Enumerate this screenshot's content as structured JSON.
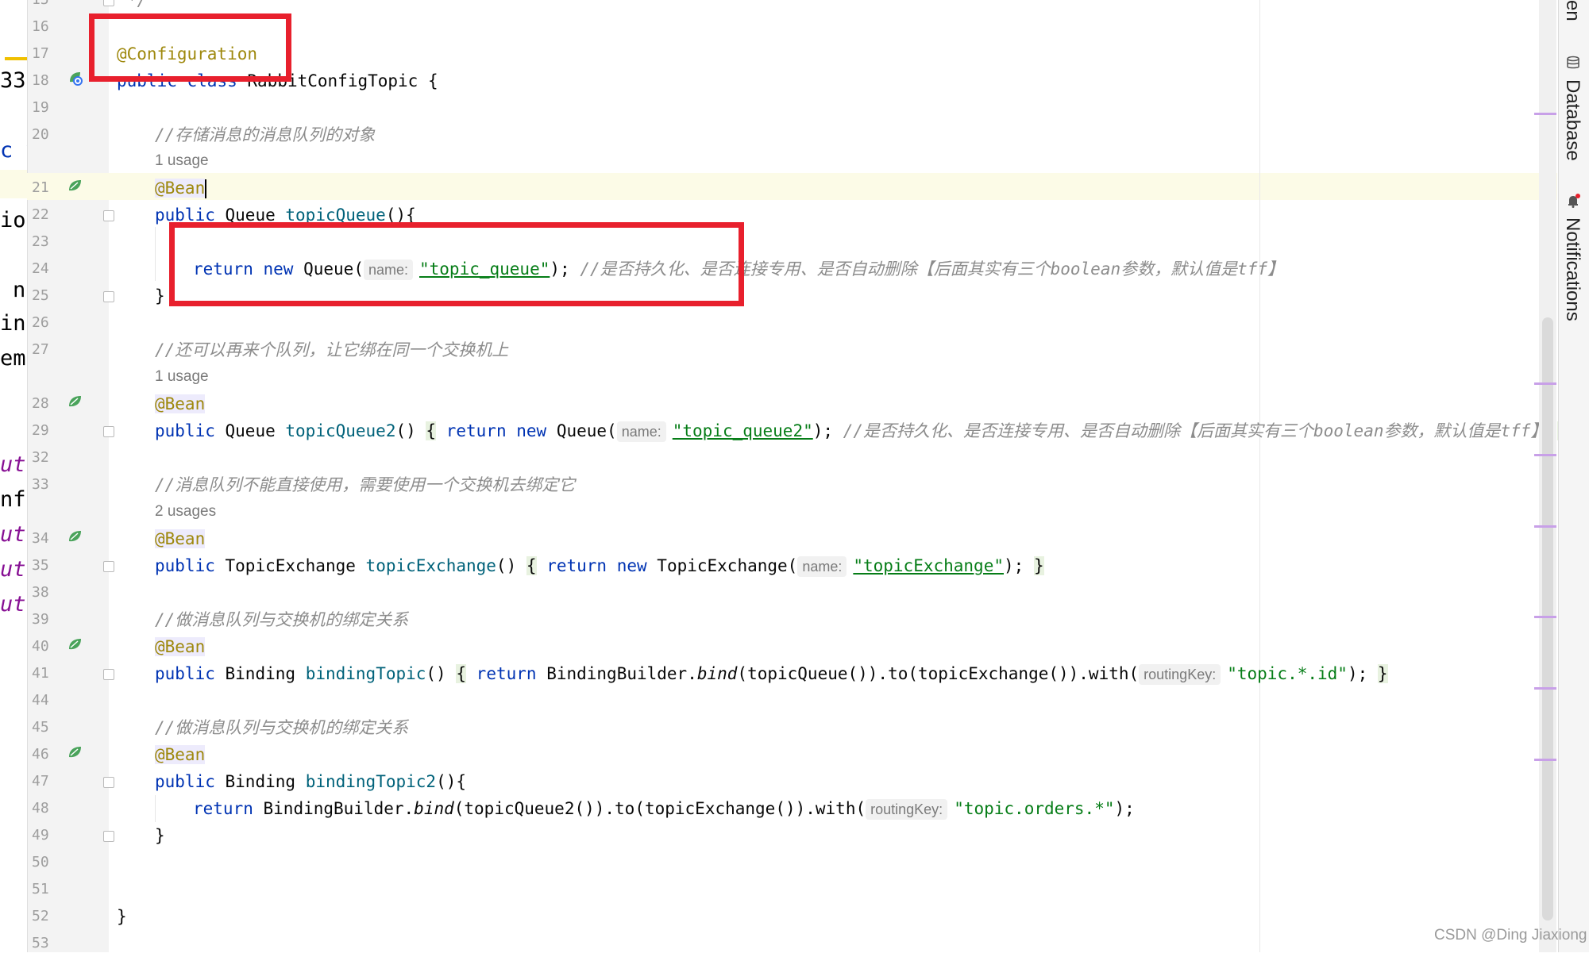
{
  "left_panel": {
    "fragments": [
      "33",
      "c v",
      "ion",
      "na",
      "ing",
      "em",
      "ut",
      "nfi",
      "ut",
      "ut",
      "ut"
    ]
  },
  "line_numbers": [
    "15",
    "16",
    "17",
    "18",
    "19",
    "20",
    "21",
    "22",
    "23",
    "24",
    "25",
    "26",
    "27",
    "28",
    "29",
    "32",
    "33",
    "34",
    "35",
    "38",
    "39",
    "40",
    "41",
    "44",
    "45",
    "46",
    "47",
    "48",
    "49",
    "50",
    "51",
    "52",
    "53"
  ],
  "code": {
    "l15": "*/",
    "l17": "@Configuration",
    "l18_kw1": "public",
    "l18_kw2": "class",
    "l18_name": "RabbitConfigTopic {",
    "l20_comment": "//存储消息的消息队列的对象",
    "usage1": "1 usage",
    "l21_ann": "@Bean",
    "l22_kw": "public",
    "l22_type": "Queue",
    "l22_fn": "topicQueue",
    "l22_rest": "(){",
    "l24_kw1": "return",
    "l24_kw2": "new",
    "l24_type": "Queue(",
    "l24_hint": "name:",
    "l24_str": "\"topic_queue\"",
    "l24_end": ");",
    "l24_comment": "//是否持久化、是否连接专用、是否自动删除【后面其实有三个boolean参数，默认值是tff】",
    "l25": "}",
    "l27_comment": "//还可以再来个队列，让它绑在同一个交换机上",
    "usage2": "1 usage",
    "l28_ann": "@Bean",
    "l29_kw": "public",
    "l29_type": "Queue",
    "l29_fn": "topicQueue2",
    "l29_parens": "()",
    "l29_open": "{",
    "l29_kw2": "return",
    "l29_kw3": "new",
    "l29_type2": "Queue(",
    "l29_hint": "name:",
    "l29_str": "\"topic_queue2\"",
    "l29_end": ");",
    "l29_comment": "//是否持久化、是否连接专用、是否自动删除【后面其实有三个boolean参数，默认值是tff】",
    "l29_close": "}",
    "l33_comment": "//消息队列不能直接使用，需要使用一个交换机去绑定它",
    "usage3": "2 usages",
    "l34_ann": "@Bean",
    "l35_kw": "public",
    "l35_type": "TopicExchange",
    "l35_fn": "topicExchange",
    "l35_parens": "()",
    "l35_open": "{",
    "l35_kw2": "return",
    "l35_kw3": "new",
    "l35_type2": "TopicExchange(",
    "l35_hint": "name:",
    "l35_str": "\"topicExchange\"",
    "l35_end": ");",
    "l35_close": "}",
    "l39_comment": "//做消息队列与交换机的绑定关系",
    "l40_ann": "@Bean",
    "l41_kw": "public",
    "l41_type": "Binding",
    "l41_fn": "bindingTopic",
    "l41_parens": "()",
    "l41_open": "{",
    "l41_kw2": "return",
    "l41_cls": "BindingBuilder.",
    "l41_bind": "bind",
    "l41_rest": "(topicQueue()).to(topicExchange()).with(",
    "l41_hint": "routingKey:",
    "l41_str": "\"topic.*.id\"",
    "l41_end": ");",
    "l41_close": "}",
    "l45_comment": "//做消息队列与交换机的绑定关系",
    "l46_ann": "@Bean",
    "l47_kw": "public",
    "l47_type": "Binding",
    "l47_fn": "bindingTopic2",
    "l47_rest": "(){",
    "l48_kw": "return",
    "l48_cls": "BindingBuilder.",
    "l48_bind": "bind",
    "l48_rest": "(topicQueue2()).to(topicExchange()).with(",
    "l48_hint": "routingKey:",
    "l48_str": "\"topic.orders.*\"",
    "l48_end": ");",
    "l49": "}",
    "l52": "}"
  },
  "right_panel": {
    "tab_top": "en",
    "database": "Database",
    "notifications": "Notifications"
  },
  "watermark": "CSDN @Ding Jiaxiong",
  "colors": {
    "keyword": "#0033b3",
    "annotation": "#9e880d",
    "string": "#067d17",
    "method": "#00627a",
    "comment": "#8c8c8c",
    "highlight_box": "#e8202d"
  }
}
